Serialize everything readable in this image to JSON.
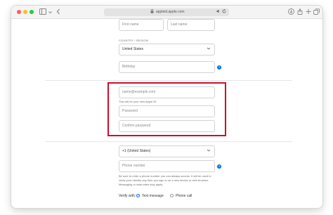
{
  "browser": {
    "url": "appleid.apple.com",
    "icons": {
      "sidebar": "sidebar-icon",
      "back": "back-chevron-icon",
      "lock": "lock-icon",
      "reload": "reload-icon",
      "download": "download-icon",
      "share": "share-icon",
      "new_tab": "plus-icon",
      "tabs": "tab-overview-icon"
    }
  },
  "form": {
    "first_name_placeholder": "First name",
    "last_name_placeholder": "Last name",
    "country_label": "COUNTRY / REGION",
    "country_value": "United States",
    "birthday_placeholder": "Birthday",
    "email_placeholder": "name@example.com",
    "email_help": "This will be your new Apple ID.",
    "password_placeholder": "Password",
    "confirm_placeholder": "Confirm password",
    "phone_country_value": "+1 (United States)",
    "phone_placeholder": "Phone number",
    "phone_help": "Be sure to enter a phone number you can always access. It will be used to verify your identity any time you sign in on a new device or web browser. Messaging or data rates may apply.",
    "verify_label": "Verify with:",
    "verify_options": [
      {
        "label": "Text message",
        "selected": true
      },
      {
        "label": "Phone call",
        "selected": false
      }
    ]
  },
  "colors": {
    "highlight": "#c8102e",
    "accent": "#0071e3"
  }
}
